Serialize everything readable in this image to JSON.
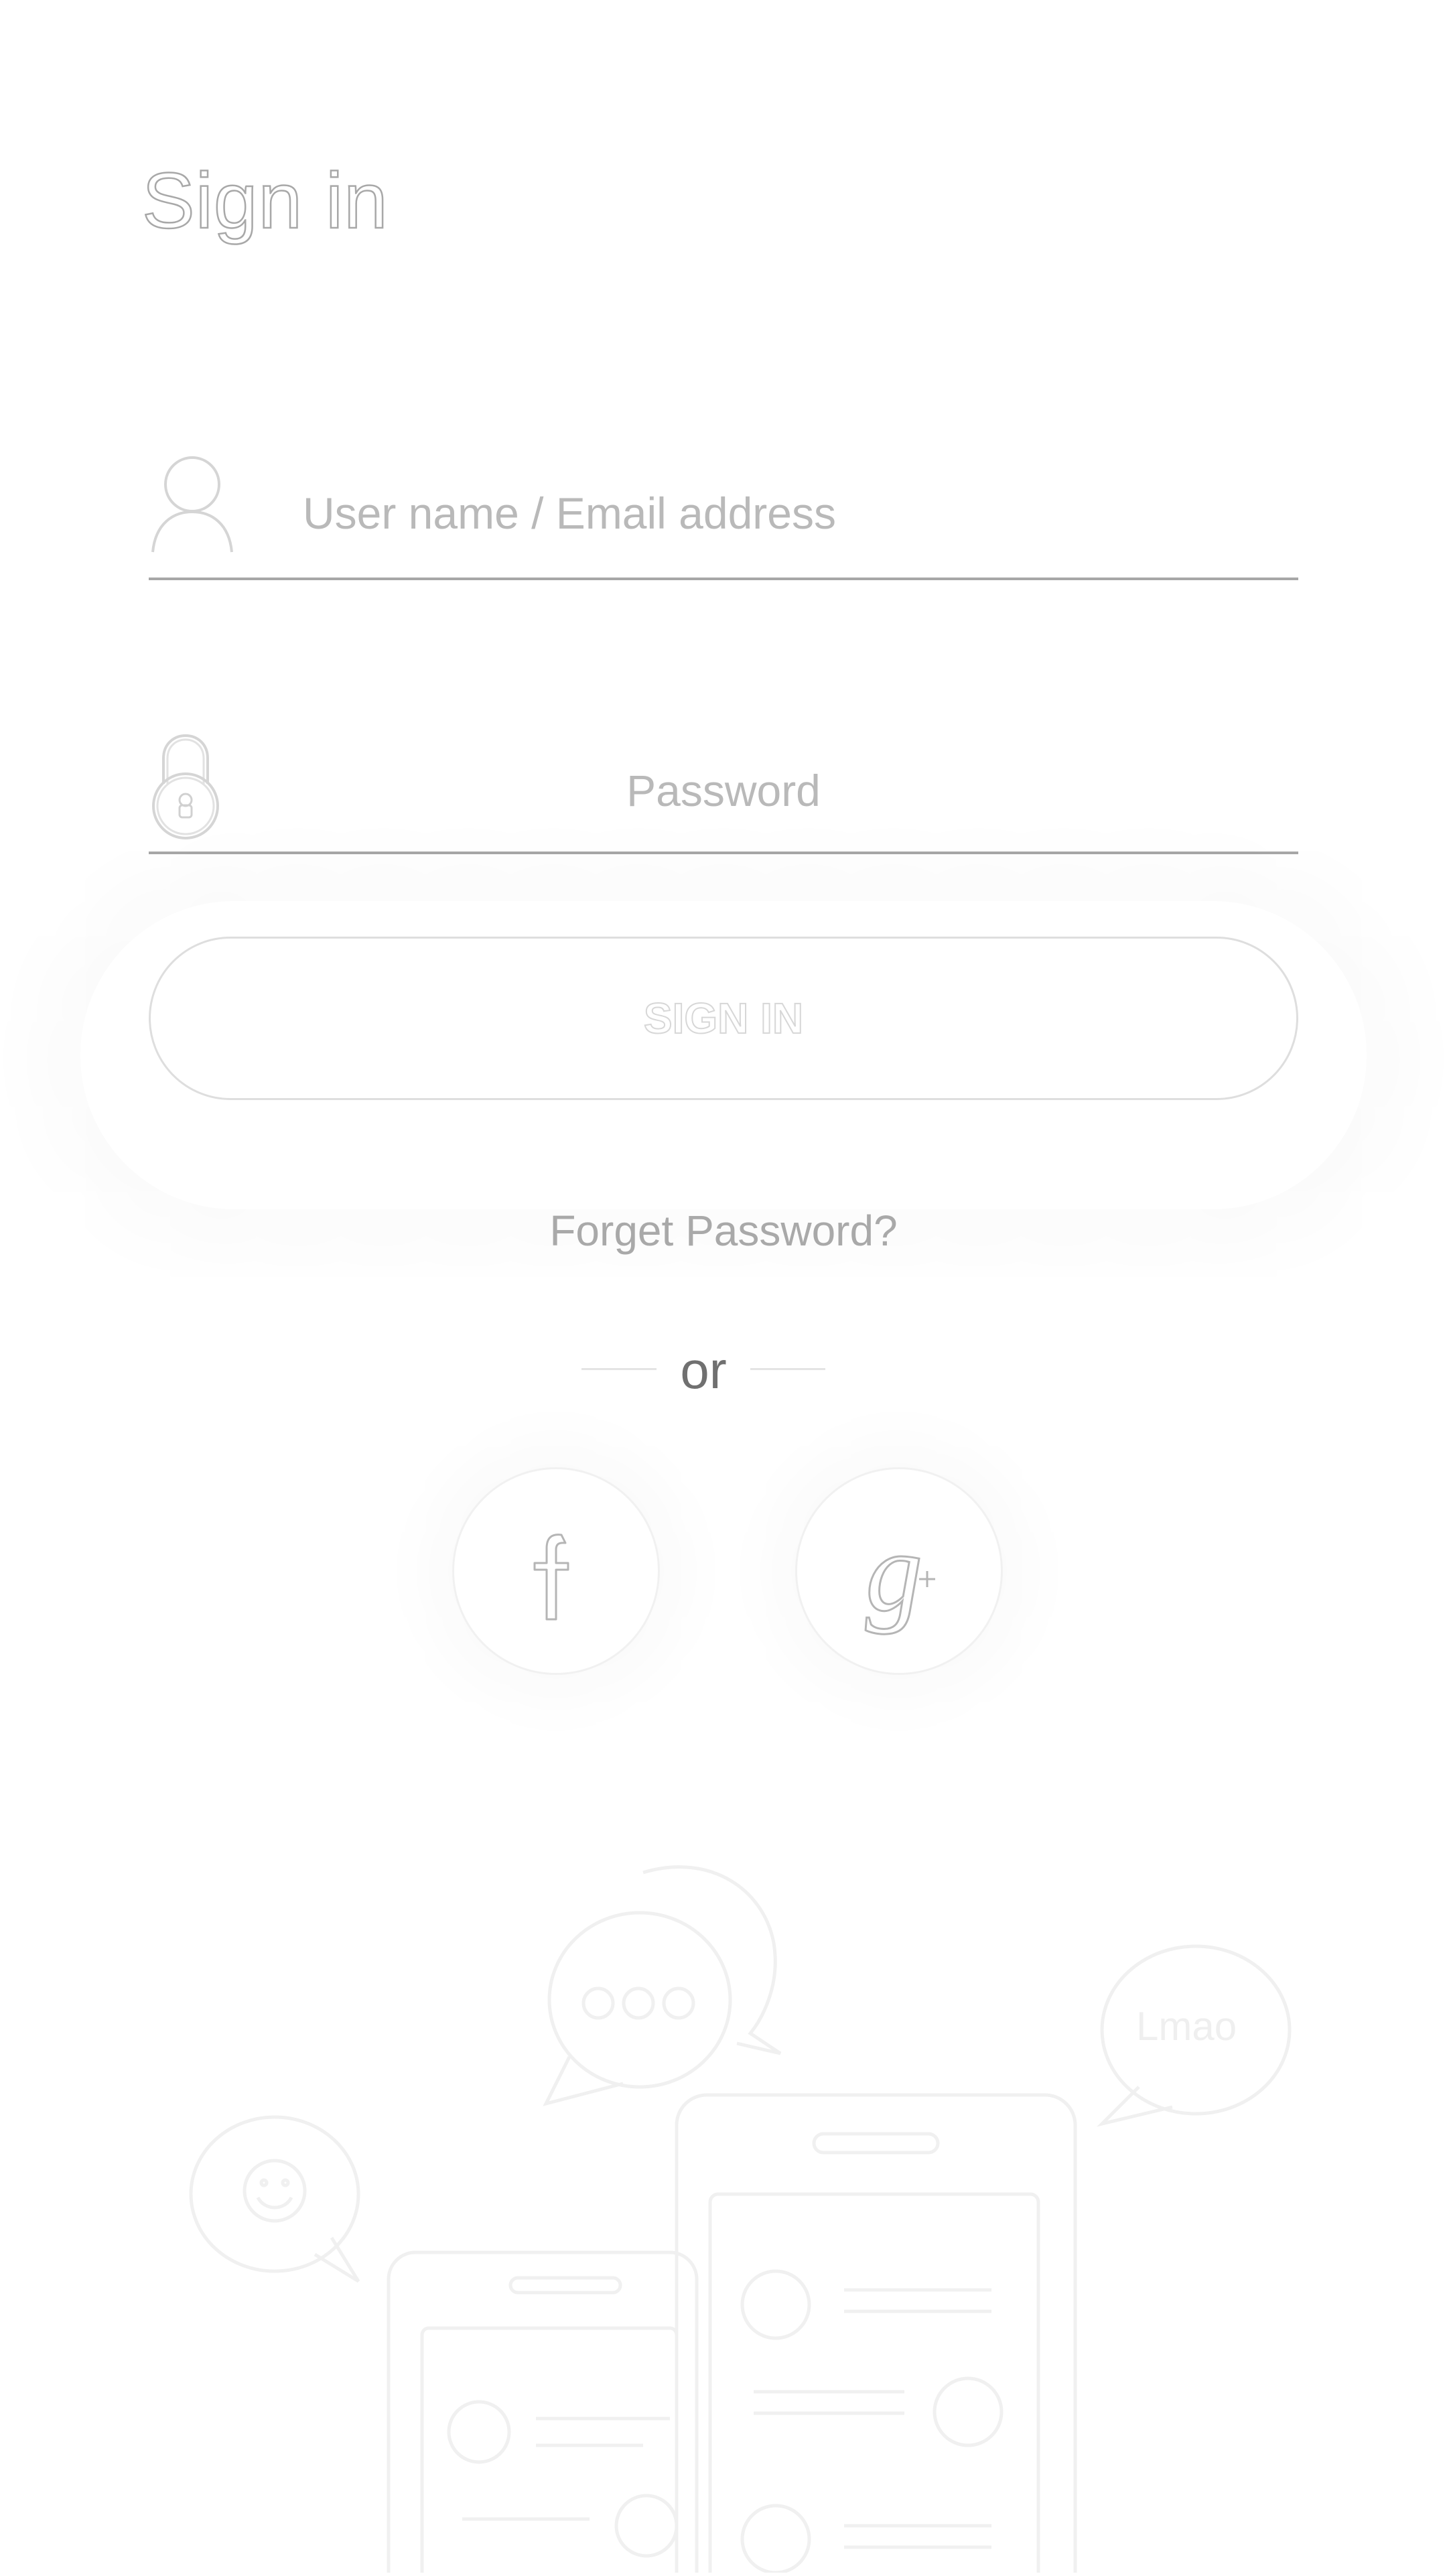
{
  "header": {
    "title": "Sign in"
  },
  "form": {
    "username_placeholder": "User name / Email address",
    "password_placeholder": "Password",
    "signin_label": "SIGN IN",
    "forgot_label": "Forget Password?"
  },
  "divider": {
    "or_label": "or"
  },
  "social": [
    {
      "name": "facebook",
      "icon": "facebook-icon"
    },
    {
      "name": "google-plus",
      "icon": "google-plus-icon"
    }
  ],
  "illustration": {
    "bubble_text": "Lmao"
  },
  "colors": {
    "background": "#ffffff",
    "line": "#a7a7a7",
    "placeholder": "#b9b9b9",
    "or_text": "#707070"
  }
}
